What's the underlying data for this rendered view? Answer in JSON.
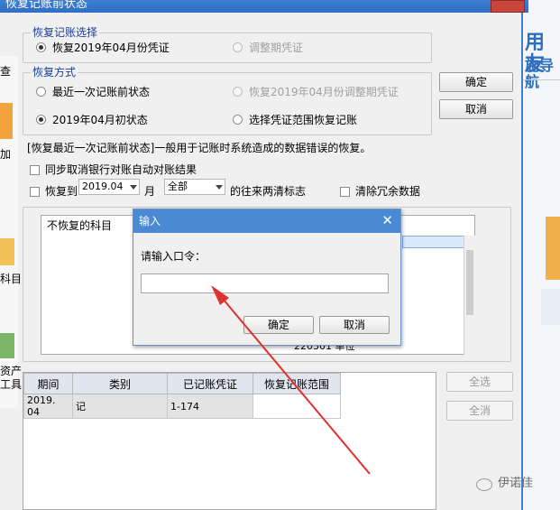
{
  "window": {
    "title": "恢复记账前状态",
    "background_app": {
      "logo_text_line1": "用友",
      "logo_text_line2": "施导航",
      "left_strip": [
        "查",
        "加",
        "科目",
        "资产",
        "工具"
      ]
    }
  },
  "recovery_choice": {
    "legend": "恢复记账选择",
    "option_month": "恢复2019年04月份凭证",
    "option_adjust": "调整期凭证",
    "selected": "option_month"
  },
  "recovery_method": {
    "legend": "恢复方式",
    "option_last": "最近一次记账前状态",
    "option_adjust_period": "恢复2019年04月份调整期凭证",
    "option_month_start": "2019年04月初状态",
    "option_range": "选择凭证范围恢复记账",
    "selected": "option_month_start"
  },
  "buttons": {
    "ok": "确定",
    "cancel": "取消",
    "select_all": "全选",
    "deselect_all": "全消"
  },
  "description": "[恢复最近一次记账前状态]一般用于记账时系统造成的数据错误的恢复。",
  "options": {
    "sync_bank": "同步取消银行对账自动对账结果",
    "recover_to": "恢复到",
    "recover_month_value": "2019.04",
    "month_label": "月",
    "recover_scope_value": "全部",
    "clear_tail": "的往来两清标志",
    "clear_redundant": "清除冗余数据"
  },
  "subject_panel": {
    "header": "不恢复的科目",
    "partial_row": "220301 单位"
  },
  "voucher_table": {
    "columns": [
      "期间",
      "类别",
      "已记账凭证",
      "恢复记账范围"
    ],
    "rows": [
      [
        "2019. 04",
        "记",
        "1-174",
        ""
      ]
    ]
  },
  "password_dialog": {
    "title": "输入",
    "prompt": "请输入口令：",
    "password_value": "",
    "ok": "确定",
    "cancel": "取消"
  },
  "watermark": {
    "text": "伊诺佳"
  },
  "colors": {
    "title_bar": "#3d7fd0",
    "legend_text": "#1c3f94",
    "arrow": "#e03030",
    "dialog_title": "#4a8ad4"
  }
}
